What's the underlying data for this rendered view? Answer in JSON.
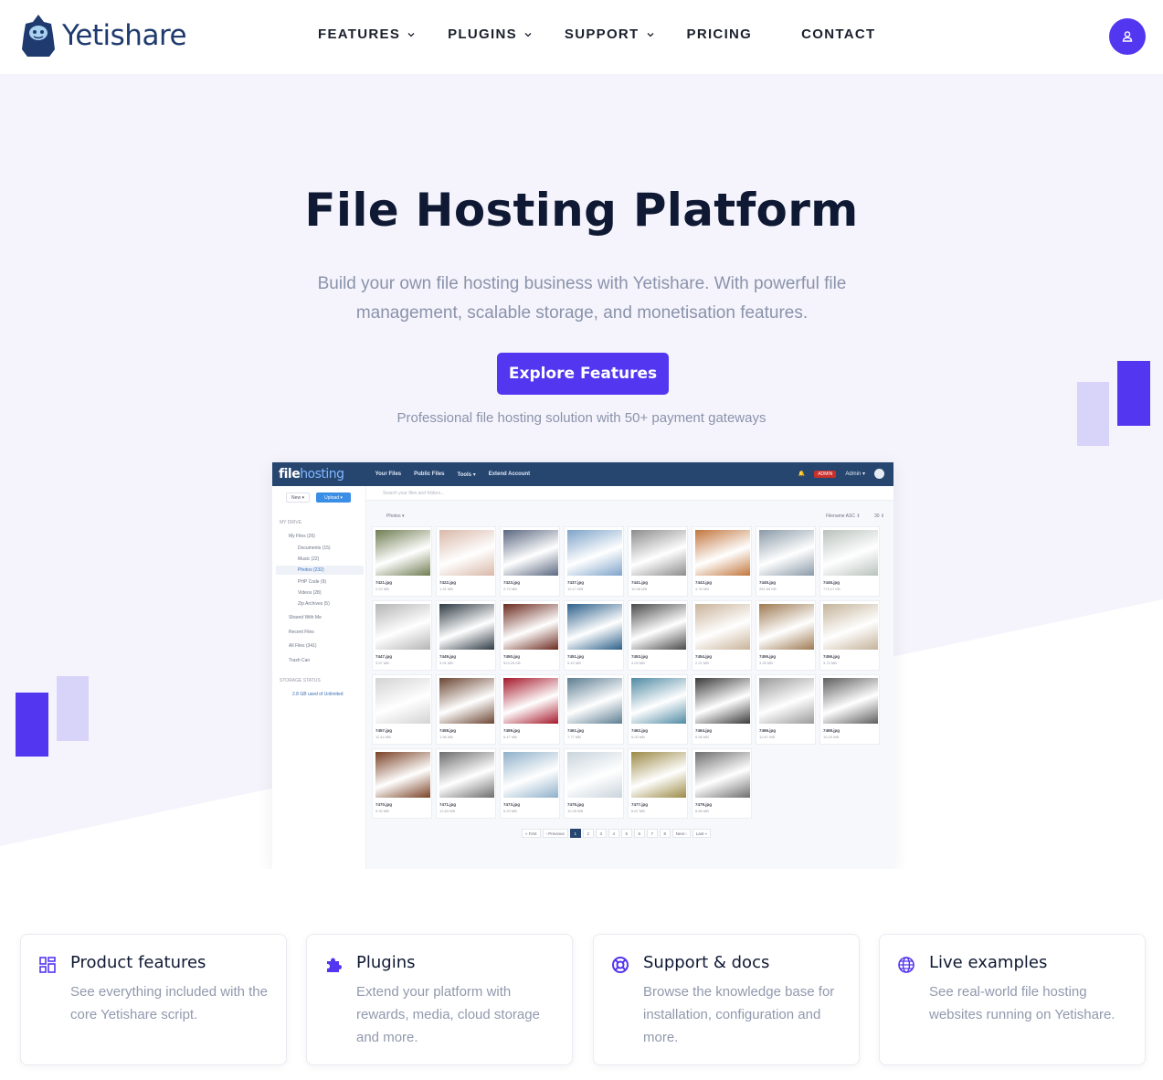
{
  "header": {
    "logo_text": "Yetishare",
    "nav": [
      {
        "label": "FEATURES",
        "has_dropdown": true
      },
      {
        "label": "PLUGINS",
        "has_dropdown": true
      },
      {
        "label": "SUPPORT",
        "has_dropdown": true
      },
      {
        "label": "PRICING",
        "has_dropdown": false
      },
      {
        "label": "CONTACT",
        "has_dropdown": false
      }
    ],
    "user_icon": "user-icon"
  },
  "hero": {
    "title": "File Hosting Platform",
    "subtitle": "Build your own file hosting business with Yetishare. With powerful file management, scalable storage, and monetisation features.",
    "cta_label": "Explore Features",
    "tagline": "Professional file hosting solution with 50+ payment gateways"
  },
  "mockup": {
    "logo_a": "file",
    "logo_b": "hosting",
    "nav": [
      "Your Files",
      "Public Files",
      "Tools ▾",
      "Extend Account"
    ],
    "badge": "ADMIN",
    "user": "Admin ▾",
    "buttons": {
      "new": "New ▾",
      "upload": "Upload ▾"
    },
    "search_placeholder": "Search your files and folders...",
    "breadcrumb": "Photos ▾",
    "sort": "Filename ASC ⇕",
    "per_page": "30 ⇕",
    "sidebar": {
      "section": "MY DRIVE",
      "items": [
        "My Files (26)",
        "Documents (15)",
        "Music (22)",
        "Photos (232)",
        "PHP Code (9)",
        "Videos (28)",
        "Zip Archives (5)",
        "Shared With Me",
        "Recent Files",
        "All Files (341)",
        "Trash Can"
      ],
      "storage_label": "STORAGE STATUS",
      "storage_value": "2.8 GB used of Unlimited"
    },
    "files": [
      {
        "name": "7421.jpg",
        "size": "2.22 MB",
        "color": "#6f7d52"
      },
      {
        "name": "7422.jpg",
        "size": "1.31 MB",
        "color": "#d9b8a8"
      },
      {
        "name": "7423.jpg",
        "size": "2.73 MB",
        "color": "#5a6780"
      },
      {
        "name": "7437.jpg",
        "size": "10.17 MB",
        "color": "#7da3c9"
      },
      {
        "name": "7441.jpg",
        "size": "10.08 MB",
        "color": "#8c8c8c"
      },
      {
        "name": "7443.jpg",
        "size": "4.76 MB",
        "color": "#c2763e"
      },
      {
        "name": "7445.jpg",
        "size": "251.59 KB",
        "color": "#8a9aa8"
      },
      {
        "name": "7446.jpg",
        "size": "774.17 KB",
        "color": "#b9c2bd"
      },
      {
        "name": "7447.jpg",
        "size": "3.57 MB",
        "color": "#b5b5b5"
      },
      {
        "name": "7449.jpg",
        "size": "3.91 MB",
        "color": "#2f3b44"
      },
      {
        "name": "7450.jpg",
        "size": "523.25 KB",
        "color": "#6b2a1e"
      },
      {
        "name": "7451.jpg",
        "size": "5.42 MB",
        "color": "#2c5f8a"
      },
      {
        "name": "7453.jpg",
        "size": "4.03 MB",
        "color": "#4a4a4a"
      },
      {
        "name": "7454.jpg",
        "size": "2.21 MB",
        "color": "#c9b39a"
      },
      {
        "name": "7455.jpg",
        "size": "3.25 MB",
        "color": "#9e7a52"
      },
      {
        "name": "7456.jpg",
        "size": "3.74 MB",
        "color": "#c4b39a"
      },
      {
        "name": "7457.jpg",
        "size": "11.44 MB",
        "color": "#d3d3d3"
      },
      {
        "name": "7458.jpg",
        "size": "1.96 MB",
        "color": "#6b4532"
      },
      {
        "name": "7459.jpg",
        "size": "6.47 MB",
        "color": "#a5172a"
      },
      {
        "name": "7461.jpg",
        "size": "7.77 MB",
        "color": "#5c7d92"
      },
      {
        "name": "7462.jpg",
        "size": "6.00 MB",
        "color": "#4f8aa3"
      },
      {
        "name": "7464.jpg",
        "size": "8.58 MB",
        "color": "#3a3a3a"
      },
      {
        "name": "7466.jpg",
        "size": "12.67 MB",
        "color": "#9a9a9a"
      },
      {
        "name": "7468.jpg",
        "size": "10.29 MB",
        "color": "#5e5e5e"
      },
      {
        "name": "7470.jpg",
        "size": "9.32 MB",
        "color": "#7a4125"
      },
      {
        "name": "7471.jpg",
        "size": "12.64 MB",
        "color": "#6d6d6d"
      },
      {
        "name": "7473.jpg",
        "size": "6.29 MB",
        "color": "#8fb0c9"
      },
      {
        "name": "7475.jpg",
        "size": "10.26 MB",
        "color": "#c9d4dc"
      },
      {
        "name": "7477.jpg",
        "size": "6.67 MB",
        "color": "#9b8a45"
      },
      {
        "name": "7479.jpg",
        "size": "8.86 MB",
        "color": "#6e6e6e"
      }
    ],
    "pager": [
      "« First",
      "‹ Previous",
      "1",
      "2",
      "3",
      "4",
      "5",
      "6",
      "7",
      "8",
      "Next ›",
      "Last »"
    ]
  },
  "cards": [
    {
      "icon": "grid-icon",
      "title": "Product features",
      "text": "See everything included with the core Yetishare script."
    },
    {
      "icon": "puzzle-icon",
      "title": "Plugins",
      "text": "Extend your platform with rewards, media, cloud storage and more."
    },
    {
      "icon": "lifebuoy-icon",
      "title": "Support & docs",
      "text": "Browse the knowledge base for installation, configuration and more."
    },
    {
      "icon": "globe-icon",
      "title": "Live examples",
      "text": "See real-world file hosting websites running on Yetishare."
    }
  ],
  "colors": {
    "accent": "#5336f0",
    "accent_light": "#d8d3f8",
    "hero_bg": "#f5f4fc",
    "mock_header": "#27466f"
  }
}
